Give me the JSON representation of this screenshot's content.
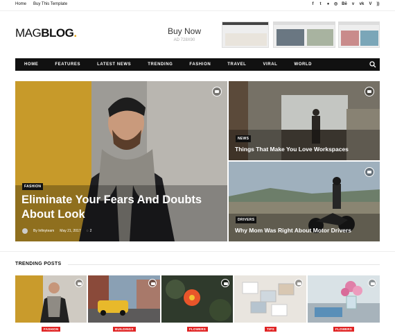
{
  "topbar": {
    "links": [
      "Home",
      "Buy This Template"
    ],
    "social_icons": [
      "facebook-icon",
      "twitter-icon",
      "pinterest-icon",
      "instagram-icon",
      "behance-icon",
      "vimeo-icon",
      "vk-icon",
      "vimeo-alt-icon",
      "rss-icon"
    ]
  },
  "logo": {
    "part1": "MAG",
    "part2": "BLOG",
    "dot": "."
  },
  "ad": {
    "title": "Buy Now",
    "size": "AD 728X90"
  },
  "nav": {
    "items": [
      "HOME",
      "FEATURES",
      "LATEST NEWS",
      "TRENDING",
      "FASHION",
      "TRAVEL",
      "VIRAL",
      "WORLD"
    ]
  },
  "hero_main": {
    "category": "FASHION",
    "title_line1": "Eliminate Your Fears And Doubts",
    "title_line2": "About Look",
    "author": "By Infinyteam",
    "date": "May 21, 2017",
    "comments": "2"
  },
  "hero_top": {
    "category": "NEWS",
    "title": "Things That Make You Love Workspaces"
  },
  "hero_bottom": {
    "category": "DRIVERS",
    "title": "Why Mom Was Right About Motor Drivers"
  },
  "trending": {
    "heading": "TRENDING POSTS",
    "items": [
      {
        "category": "FASHION"
      },
      {
        "category": "BUILDINGS"
      },
      {
        "category": "FLOWERS"
      },
      {
        "category": "TIPS"
      },
      {
        "category": "FLOWERS"
      }
    ]
  },
  "colors": {
    "accent": "#e6a516",
    "badge": "#e02424",
    "nav": "#111111"
  }
}
